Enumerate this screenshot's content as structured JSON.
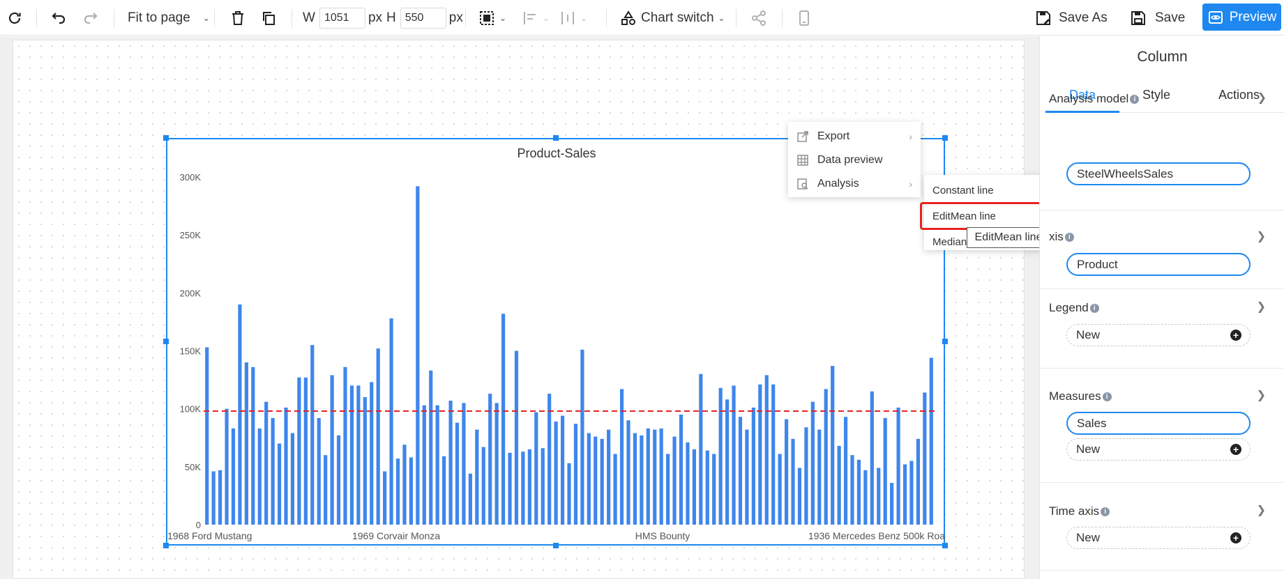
{
  "toolbar": {
    "fit_label": "Fit to page",
    "w_label": "W",
    "width_value": "1051",
    "px_label": "px",
    "h_label": "H",
    "height_value": "550",
    "chart_switch_label": "Chart switch",
    "save_as_label": "Save As",
    "save_label": "Save",
    "preview_label": "Preview",
    "accent_color": "#1e88f0"
  },
  "context_menu": {
    "items": [
      {
        "label": "Export",
        "icon": "export-icon"
      },
      {
        "label": "Data preview",
        "icon": "table-icon"
      },
      {
        "label": "Analysis",
        "icon": "analysis-icon"
      }
    ],
    "submenu": [
      "Constant line",
      "EditMean line",
      "Median"
    ],
    "highlighted": "EditMean line",
    "tooltip": "EditMean line",
    "highlight_color": "#e52222"
  },
  "panel": {
    "title": "Column",
    "tabs": [
      "Data",
      "Style",
      "Actions"
    ],
    "active_tab": "Data",
    "analysis_model": {
      "label": "Analysis model",
      "value": "SteelWheelsSales"
    },
    "axis": {
      "label": "xis",
      "value": "Product"
    },
    "legend": {
      "label": "Legend",
      "new_label": "New"
    },
    "measures": {
      "label": "Measures",
      "value": "Sales",
      "new_label": "New"
    },
    "time_axis": {
      "label": "Time axis",
      "new_label": "New"
    }
  },
  "chart_data": {
    "type": "bar",
    "title": "Product-Sales",
    "xlabel": "",
    "ylabel": "",
    "ylim": [
      0,
      300000
    ],
    "y_ticks": [
      "0",
      "50K",
      "100K",
      "150K",
      "200K",
      "250K",
      "300K"
    ],
    "x_tick_labels": [
      "1968 Ford Mustang",
      "1969 Corvair Monza",
      "HMS Bounty",
      "1936 Mercedes Benz 500k Roa"
    ],
    "bar_color": "#3f86ec",
    "mean_line": {
      "value": 98000,
      "color": "#e52222"
    },
    "values": [
      153000,
      46000,
      47000,
      100000,
      83000,
      190000,
      140000,
      136000,
      83000,
      106000,
      92000,
      70000,
      101000,
      79000,
      127000,
      127000,
      155000,
      92000,
      60000,
      129000,
      77000,
      136000,
      120000,
      120000,
      110000,
      123000,
      152000,
      46000,
      178000,
      57000,
      69000,
      58000,
      292000,
      103000,
      133000,
      103000,
      59000,
      107000,
      88000,
      105000,
      44000,
      82000,
      67000,
      113000,
      105000,
      182000,
      62000,
      150000,
      63000,
      65000,
      97000,
      66000,
      113000,
      89000,
      94000,
      53000,
      87000,
      151000,
      79000,
      76000,
      74000,
      82000,
      61000,
      117000,
      90000,
      79000,
      77000,
      83000,
      82000,
      83000,
      61000,
      76000,
      95000,
      71000,
      65000,
      130000,
      64000,
      61000,
      118000,
      108000,
      120000,
      93000,
      82000,
      101000,
      121000,
      129000,
      121000,
      61000,
      91000,
      74000,
      49000,
      84000,
      106000,
      82000,
      117000,
      137000,
      68000,
      93000,
      60000,
      56000,
      47000,
      115000,
      49000,
      92000,
      36000,
      101000,
      52000,
      55000,
      74000,
      114000,
      144000
    ]
  }
}
